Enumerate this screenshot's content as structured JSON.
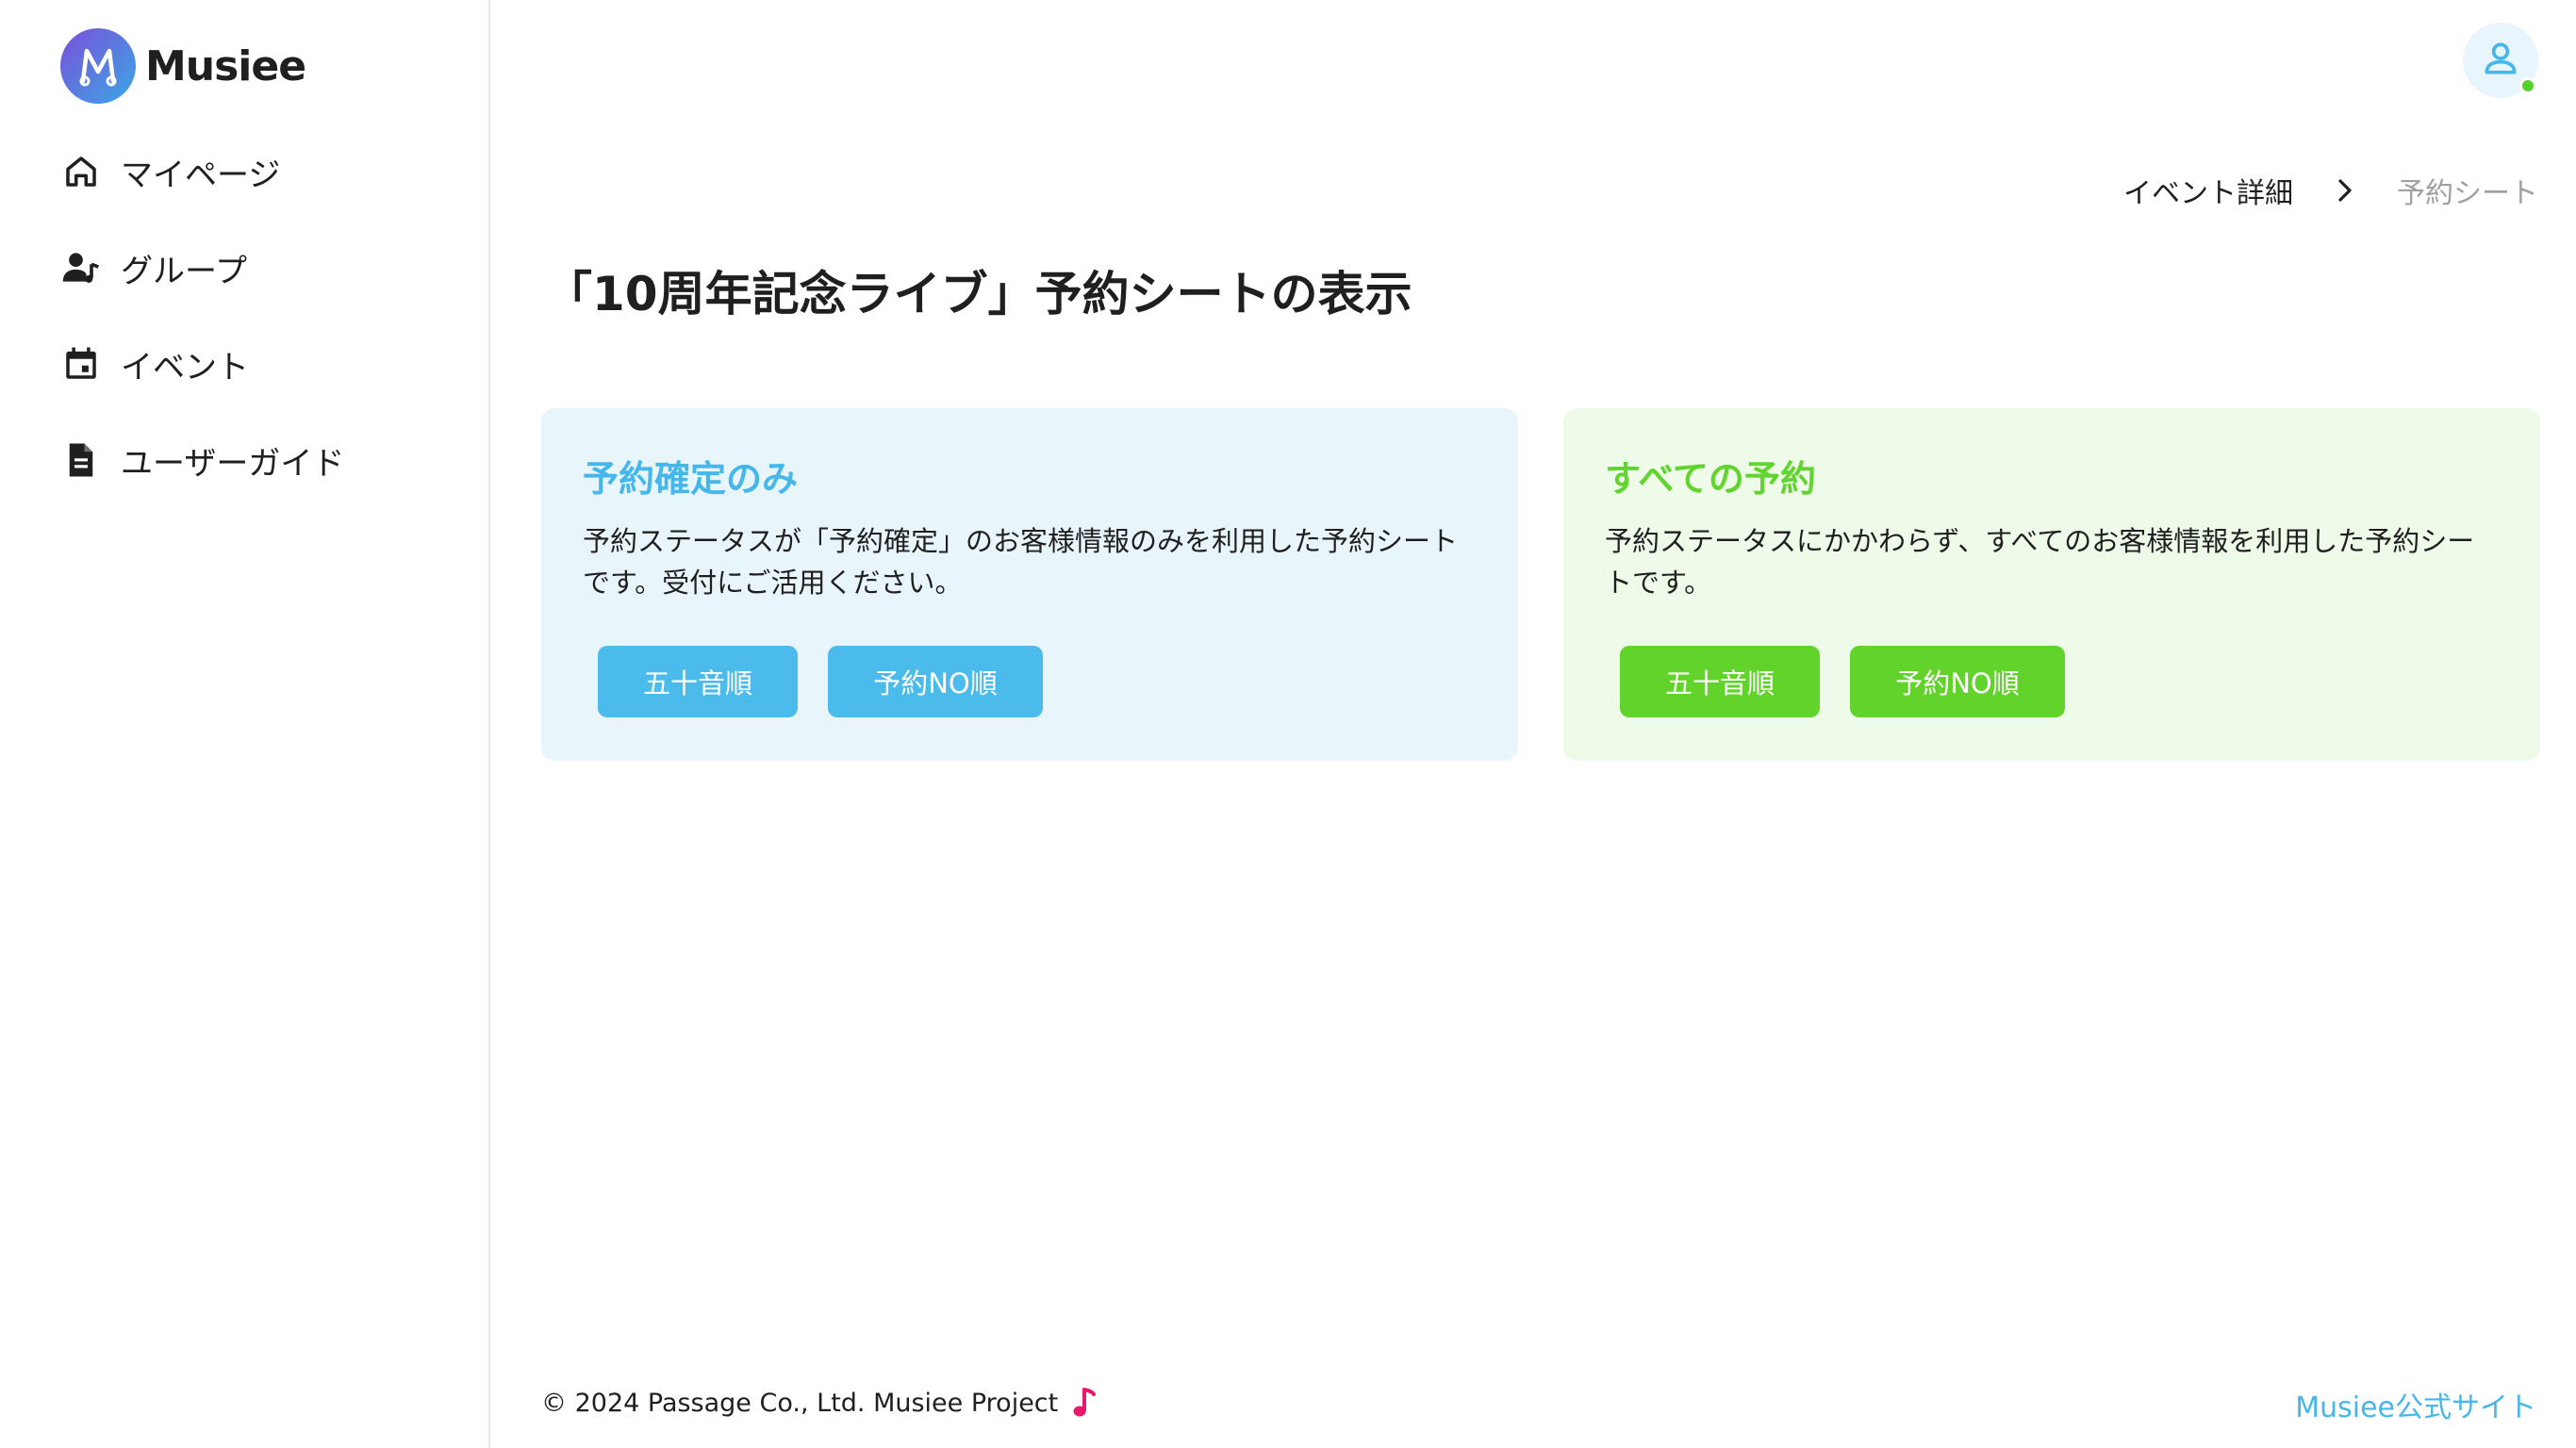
{
  "brand": {
    "name": "Musiee",
    "gradient_start": "#7b4fd9",
    "gradient_end": "#3aa8e6"
  },
  "sidebar": {
    "items": [
      {
        "label": "マイページ",
        "icon": "home-icon"
      },
      {
        "label": "グループ",
        "icon": "user-music-icon"
      },
      {
        "label": "イベント",
        "icon": "calendar-icon"
      },
      {
        "label": "ユーザーガイド",
        "icon": "document-icon"
      }
    ]
  },
  "header": {
    "avatar_icon": "user-icon",
    "status_color": "#56d02b"
  },
  "breadcrumb": {
    "parent": "イベント詳細",
    "current": "予約シート"
  },
  "page": {
    "title": "「10周年記念ライブ」予約シートの表示"
  },
  "cards": {
    "confirmed": {
      "title": "予約確定のみ",
      "description": "予約ステータスが「予約確定」のお客様情報のみを利用した予約シートです。受付にご活用ください。",
      "btn_kana": "五十音順",
      "btn_no": "予約NO順",
      "accent": "#4bbbec"
    },
    "all": {
      "title": "すべての予約",
      "description": "予約ステータスにかかわらず、すべてのお客様情報を利用した予約シートです。",
      "btn_kana": "五十音順",
      "btn_no": "予約NO順",
      "accent": "#62d32b"
    }
  },
  "footer": {
    "copyright": "© 2024 Passage Co., Ltd. Musiee Project",
    "official_link": "Musiee公式サイト",
    "note_color": "#e8196b"
  }
}
